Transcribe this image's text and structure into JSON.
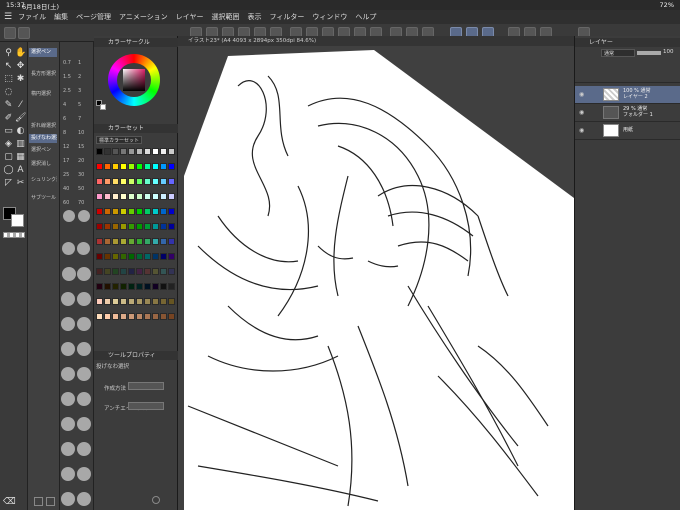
{
  "status": {
    "time": "15:37",
    "date": "6月18日(土)",
    "battery": "72%"
  },
  "menu": [
    "ファイル",
    "編集",
    "ページ管理",
    "アニメーション",
    "レイヤー",
    "選択範囲",
    "表示",
    "フィルター",
    "ウィンドウ",
    "ヘルプ"
  ],
  "canvas_tab": "イラスト23* (A4 4093 x 2894px 350dpi 84.6%)",
  "subtool": {
    "items": [
      "選択ペン",
      "長方形選択",
      "楕円選択",
      "折れ線選択",
      "投げなわ選択",
      "選択ペン",
      "選択消し",
      "シュリンク選択",
      "サブツール"
    ]
  },
  "brush_sizes": [
    "0.7",
    "1",
    "1.5",
    "2",
    "2.5",
    "3",
    "4",
    "5",
    "6",
    "7",
    "8",
    "10",
    "12",
    "15",
    "17",
    "20",
    "25",
    "30",
    "40",
    "50",
    "60",
    "70",
    "80",
    "100",
    "120",
    "150",
    "170",
    "200",
    "250",
    "300",
    "400",
    "500",
    "600",
    "700",
    "800",
    "1000"
  ],
  "color_panel": {
    "title_wheel": "カラーサークル",
    "title_set": "カラーセット",
    "set_name": "標準カラーセット",
    "tool_prop_title": "ツールプロパティ",
    "tool_prop_sub": "投げなわ選択",
    "prop_mode": "作成方法",
    "prop_aa": "アンチエイリアス"
  },
  "layers": {
    "title": "レイヤー",
    "blend": "通常",
    "opacity": "100",
    "rows": [
      {
        "line1": "100 % 通常",
        "line2": "レイヤー 2",
        "selected": true
      },
      {
        "line1": "29 % 通常",
        "line2": "フォルダー 1",
        "selected": false
      },
      {
        "line1": "",
        "line2": "用紙",
        "selected": false
      }
    ]
  },
  "colors": {
    "accent": "#5a6a8a",
    "bg": "#3c3c3c",
    "paper": "#ffffff"
  }
}
